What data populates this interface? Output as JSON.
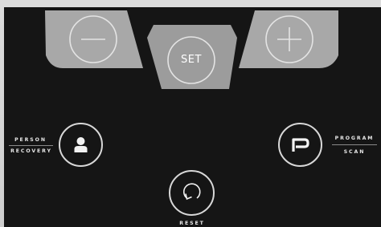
{
  "controls": {
    "minus": {
      "icon": "minus-icon"
    },
    "plus": {
      "icon": "plus-icon"
    },
    "set": {
      "label": "SET"
    }
  },
  "person_recovery": {
    "top_label": "PERSON",
    "bottom_label": "RECOVERY",
    "icon": "person-icon"
  },
  "program_scan": {
    "top_label": "PROGRAM",
    "bottom_label": "SCAN",
    "icon": "p-letter-icon"
  },
  "reset": {
    "label": "RESET",
    "icon": "circular-arrow-icon"
  },
  "colors": {
    "panel": "#151515",
    "pad_grey": "#a9a9a9",
    "set_grey": "#9c9c9c",
    "line": "#e6e6e6",
    "text": "#e8e8e8",
    "frame": "#dcdcdc"
  }
}
